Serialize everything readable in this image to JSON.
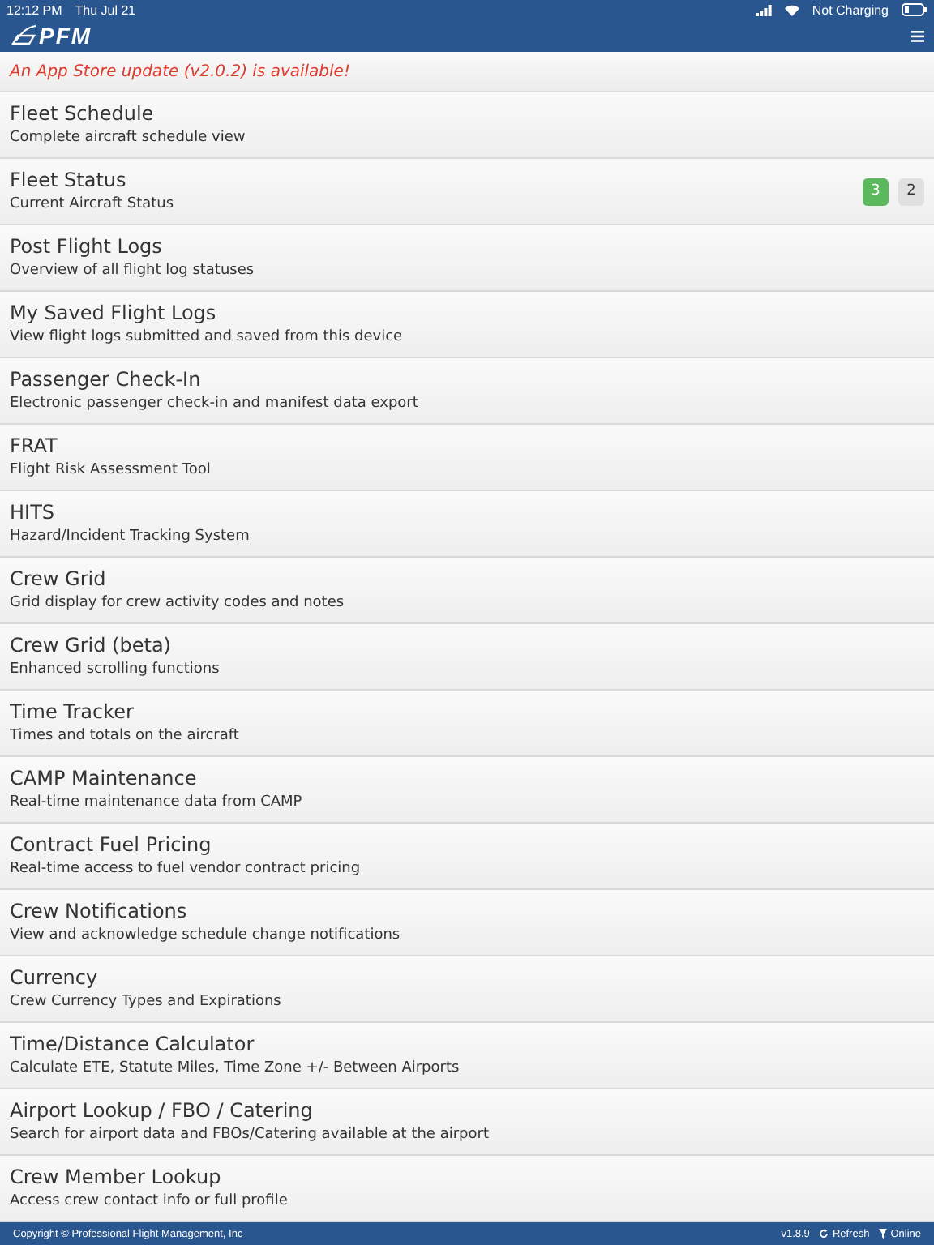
{
  "status_bar": {
    "time": "12:12 PM",
    "date": "Thu Jul 21",
    "battery_text": "Not Charging"
  },
  "header": {
    "logo_text": "PFM"
  },
  "banner": {
    "text": "An App Store update (v2.0.2) is available!"
  },
  "menu_items": [
    {
      "title": "Fleet Schedule",
      "subtitle": "Complete aircraft schedule view"
    },
    {
      "title": "Fleet Status",
      "subtitle": "Current Aircraft Status",
      "badges": [
        {
          "text": "3",
          "color": "#5cb85c"
        },
        {
          "text": "2",
          "color": "#e0e0e0"
        }
      ]
    },
    {
      "title": "Post Flight Logs",
      "subtitle": "Overview of all flight log statuses"
    },
    {
      "title": "My Saved Flight Logs",
      "subtitle": "View flight logs submitted and saved from this device"
    },
    {
      "title": "Passenger Check-In",
      "subtitle": "Electronic passenger check-in and manifest data export"
    },
    {
      "title": "FRAT",
      "subtitle": "Flight Risk Assessment Tool"
    },
    {
      "title": "HITS",
      "subtitle": "Hazard/Incident Tracking System"
    },
    {
      "title": "Crew Grid",
      "subtitle": "Grid display for crew activity codes and notes"
    },
    {
      "title": "Crew Grid (beta)",
      "subtitle": "Enhanced scrolling functions"
    },
    {
      "title": "Time Tracker",
      "subtitle": "Times and totals on the aircraft"
    },
    {
      "title": "CAMP Maintenance",
      "subtitle": "Real-time maintenance data from CAMP"
    },
    {
      "title": "Contract Fuel Pricing",
      "subtitle": "Real-time access to fuel vendor contract pricing"
    },
    {
      "title": "Crew Notifications",
      "subtitle": "View and acknowledge schedule change notifications"
    },
    {
      "title": "Currency",
      "subtitle": "Crew Currency Types and Expirations"
    },
    {
      "title": "Time/Distance Calculator",
      "subtitle": "Calculate ETE, Statute Miles, Time Zone +/- Between Airports"
    },
    {
      "title": "Airport Lookup / FBO / Catering",
      "subtitle": "Search for airport data and FBOs/Catering available at the airport"
    },
    {
      "title": "Crew Member Lookup",
      "subtitle": "Access crew contact info or full profile"
    }
  ],
  "footer": {
    "copyright": "Copyright © Professional Flight Management, Inc",
    "version": "v1.8.9",
    "refresh": "Refresh",
    "online": "Online"
  }
}
